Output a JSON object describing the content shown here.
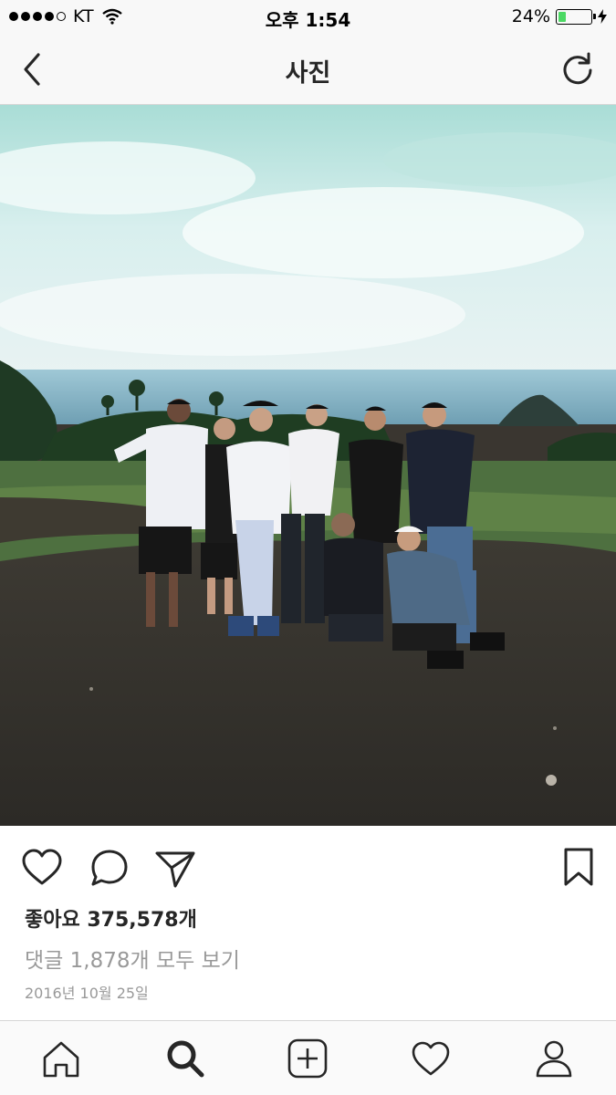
{
  "status_bar": {
    "carrier": "KT",
    "time": "오후 1:54",
    "battery_percent": "24%",
    "battery_level": 0.24,
    "signal_bars": 4
  },
  "nav": {
    "title": "사진",
    "back_icon": "chevron-left-icon",
    "refresh_icon": "refresh-icon"
  },
  "post": {
    "likes_label": "좋아요 375,578개",
    "comments_link": "댓글 1,878개 모두 보기",
    "date": "2016년 10월 25일"
  },
  "action_icons": [
    "heart-icon",
    "comment-icon",
    "share-icon",
    "bookmark-icon"
  ],
  "tab_bar": {
    "items": [
      "home-icon",
      "search-icon",
      "add-icon",
      "activity-heart-icon",
      "profile-icon"
    ],
    "active": "search-icon"
  },
  "colors": {
    "text": "#262626",
    "muted": "#999999",
    "battery_green": "#4cd964",
    "bar_bg": "#f8f8f8"
  }
}
